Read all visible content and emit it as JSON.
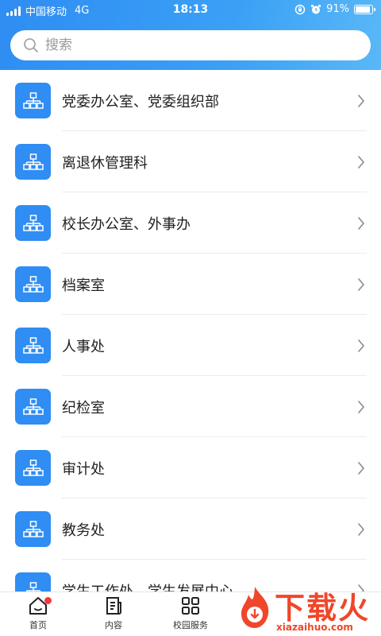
{
  "status_bar": {
    "carrier": "中国移动",
    "network": "4G",
    "time": "18:13",
    "battery": "91%",
    "battery_level": 0.91
  },
  "search": {
    "placeholder": "搜索"
  },
  "departments": [
    {
      "label": "党委办公室、党委组织部"
    },
    {
      "label": "离退休管理科"
    },
    {
      "label": "校长办公室、外事办"
    },
    {
      "label": "档案室"
    },
    {
      "label": "人事处"
    },
    {
      "label": "纪检室"
    },
    {
      "label": "审计处"
    },
    {
      "label": "教务处"
    },
    {
      "label": "学生工作处、学生发展中心"
    }
  ],
  "tabbar": {
    "home": "首页",
    "content": "内容",
    "service": "校园服务"
  },
  "watermark": {
    "brand": "下载火",
    "url": "xiazaihuo.com"
  },
  "colors": {
    "accent": "#2f8df3",
    "badge": "#f23a3a",
    "watermark": "#f0462a"
  }
}
